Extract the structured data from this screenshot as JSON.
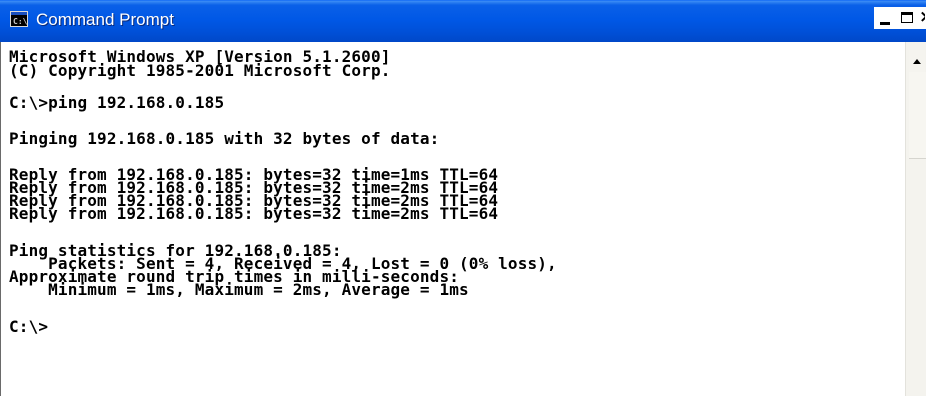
{
  "window": {
    "title": "Command Prompt",
    "icon": "command-prompt-icon",
    "icon_text": "C:\\",
    "buttons": {
      "minimize": "minimize-icon",
      "maximize": "maximize-icon",
      "close": "close-icon"
    }
  },
  "console": {
    "lines": [
      "Microsoft Windows XP [Version 5.1.2600]",
      "(C) Copyright 1985-2001 Microsoft Corp.",
      "C:\\>ping 192.168.0.185",
      "Pinging 192.168.0.185 with 32 bytes of data:",
      "Reply from 192.168.0.185: bytes=32 time=1ms TTL=64",
      "Reply from 192.168.0.185: bytes=32 time=2ms TTL=64",
      "Reply from 192.168.0.185: bytes=32 time=2ms TTL=64",
      "Reply from 192.168.0.185: bytes=32 time=2ms TTL=64",
      "Ping statistics for 192.168.0.185:",
      "    Packets: Sent = 4, Received = 4, Lost = 0 (0% loss),",
      "Approximate round trip times in milli-seconds:",
      "    Minimum = 1ms, Maximum = 2ms, Average = 1ms",
      "C:\\>"
    ]
  },
  "scrollbar": {
    "up_arrow": "scroll-up-arrow-icon"
  },
  "colors": {
    "titlebar": "#0058e6",
    "console_bg": "#ffffff",
    "console_text": "#000000"
  }
}
